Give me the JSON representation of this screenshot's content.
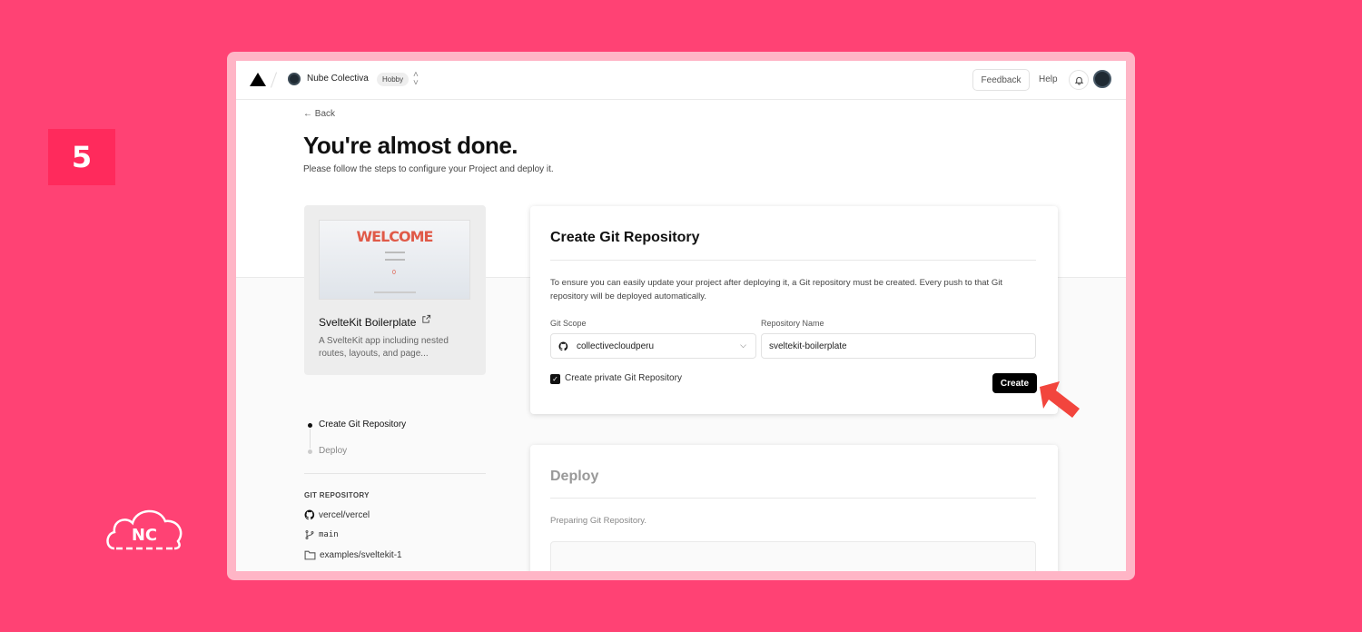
{
  "tutorial": {
    "step_number": "5",
    "brand_logo_text": "NC"
  },
  "topbar": {
    "team_name": "Nube Colectiva",
    "plan": "Hobby",
    "feedback_label": "Feedback",
    "help_label": "Help"
  },
  "page": {
    "back_label": "← Back",
    "title": "You're almost done.",
    "subtitle": "Please follow the steps to configure your Project and deploy it."
  },
  "template": {
    "preview_heading": "WELCOME",
    "preview_counter": "0",
    "name": "SvelteKit Boilerplate",
    "description": "A SvelteKit app including nested routes, layouts, and page..."
  },
  "steps": [
    {
      "label": "Create Git Repository",
      "active": true
    },
    {
      "label": "Deploy",
      "active": false
    }
  ],
  "git_repository": {
    "heading": "GIT REPOSITORY",
    "repo": "vercel/vercel",
    "branch": "main",
    "directory": "examples/sveltekit-1"
  },
  "create_card": {
    "title": "Create Git Repository",
    "description": "To ensure you can easily update your project after deploying it, a Git repository must be created. Every push to that Git repository will be deployed automatically.",
    "scope_label": "Git Scope",
    "scope_value": "collectivecloudperu",
    "repo_name_label": "Repository Name",
    "repo_name_value": "sveltekit-boilerplate",
    "private_label": "Create private Git Repository",
    "private_checked": true,
    "create_label": "Create"
  },
  "deploy_card": {
    "title": "Deploy",
    "status": "Preparing Git Repository."
  },
  "colors": {
    "background": "#ff4274",
    "badge": "#ff2a5c",
    "frame": "#ffb5c6",
    "arrow": "#f2453d"
  },
  "icons": [
    "vercel-logo-icon",
    "chevron-updown-icon",
    "bell-icon",
    "external-link-icon",
    "github-icon",
    "git-branch-icon",
    "folder-icon",
    "chevron-down-icon",
    "check-icon",
    "arrow-pointer-icon",
    "cloud-icon"
  ]
}
